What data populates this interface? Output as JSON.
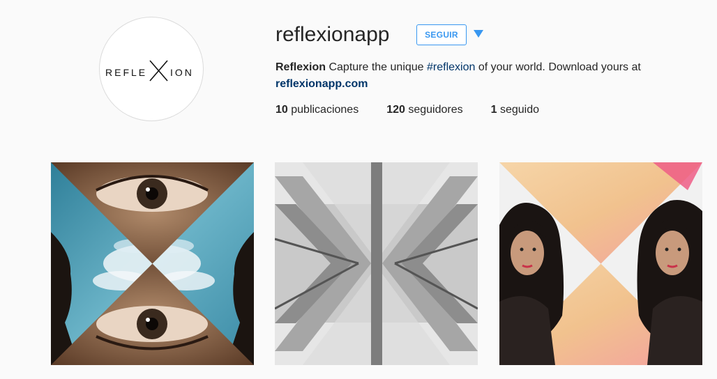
{
  "profile": {
    "avatar_logo_left": "REFLE",
    "avatar_logo_right": "ION",
    "username": "reflexionapp",
    "follow_label": "SEGUIR",
    "bio_name": "Reflexion",
    "bio_text_1": " Capture the unique ",
    "bio_hashtag": "#reflexion",
    "bio_text_2": " of your world. Download yours at",
    "bio_link": "reflexionapp.com"
  },
  "stats": {
    "posts_count": "10",
    "posts_label": " publicaciones",
    "followers_count": "120",
    "followers_label": " seguidores",
    "following_count": "1",
    "following_label": " seguido"
  },
  "posts": [
    {
      "subject": "eye-sky-reflection"
    },
    {
      "subject": "architecture-reflection"
    },
    {
      "subject": "portrait-reflection"
    }
  ],
  "colors": {
    "accent": "#3897f0",
    "link": "#003569",
    "background": "#fafafa"
  }
}
